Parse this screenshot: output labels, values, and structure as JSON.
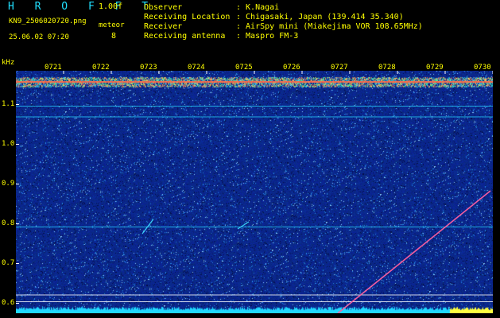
{
  "header": {
    "app_title": "H R O F F T",
    "version": "1.00f",
    "file_name": "KN9_2506020720.png",
    "meteor_label": "meteor",
    "meteor_count": "8",
    "datetime": "25.06.02 07:20"
  },
  "info": [
    {
      "key": "Observer",
      "value": ": K.Nagai"
    },
    {
      "key": "Receiving Location",
      "value": ": Chigasaki, Japan (139.414 35.340)"
    },
    {
      "key": "Receiver",
      "value": ": AirSpy mini (Miakejima VOR 108.65MHz)"
    },
    {
      "key": "Receiving antenna",
      "value": ": Maspro FM-3"
    }
  ],
  "colors": {
    "background": "#0a1f86",
    "label": "#ffff00",
    "title": "#21e0ff",
    "carrier": "#ff6a4a",
    "line_cyan": "#28d8ff",
    "meteor_trace": "#ff60a0"
  },
  "chart_data": {
    "type": "heatmap",
    "yunit": "kHz",
    "y_ticks": [
      "1.1",
      "1.0",
      "0.9",
      "0.8",
      "0.7",
      "0.6"
    ],
    "y_tick_values": [
      1.1,
      1.0,
      0.9,
      0.8,
      0.7,
      0.6
    ],
    "x_ticks": [
      "0721",
      "0722",
      "0723",
      "0724",
      "0725",
      "0726",
      "0727",
      "0728",
      "0729",
      "0730"
    ],
    "x_tick_minutes": [
      1,
      2,
      3,
      4,
      5,
      6,
      7,
      8,
      9,
      10
    ],
    "xlim_minutes": [
      0,
      10
    ],
    "ylim": [
      0.575,
      1.185
    ],
    "carrier_khz": 1.157,
    "horizontal_lines_khz": [
      1.096,
      1.069,
      0.792,
      0.621,
      0.604
    ],
    "drifting_trace": {
      "start_minute": 6.75,
      "start_khz": 0.575,
      "end_minute": 9.95,
      "end_khz": 0.883
    },
    "meteor_echoes": [
      {
        "minute": 2.75,
        "khz_from": 0.775,
        "khz_to": 0.812
      },
      {
        "minute": 4.75,
        "khz_from": 0.787,
        "khz_to": 0.805
      }
    ]
  }
}
